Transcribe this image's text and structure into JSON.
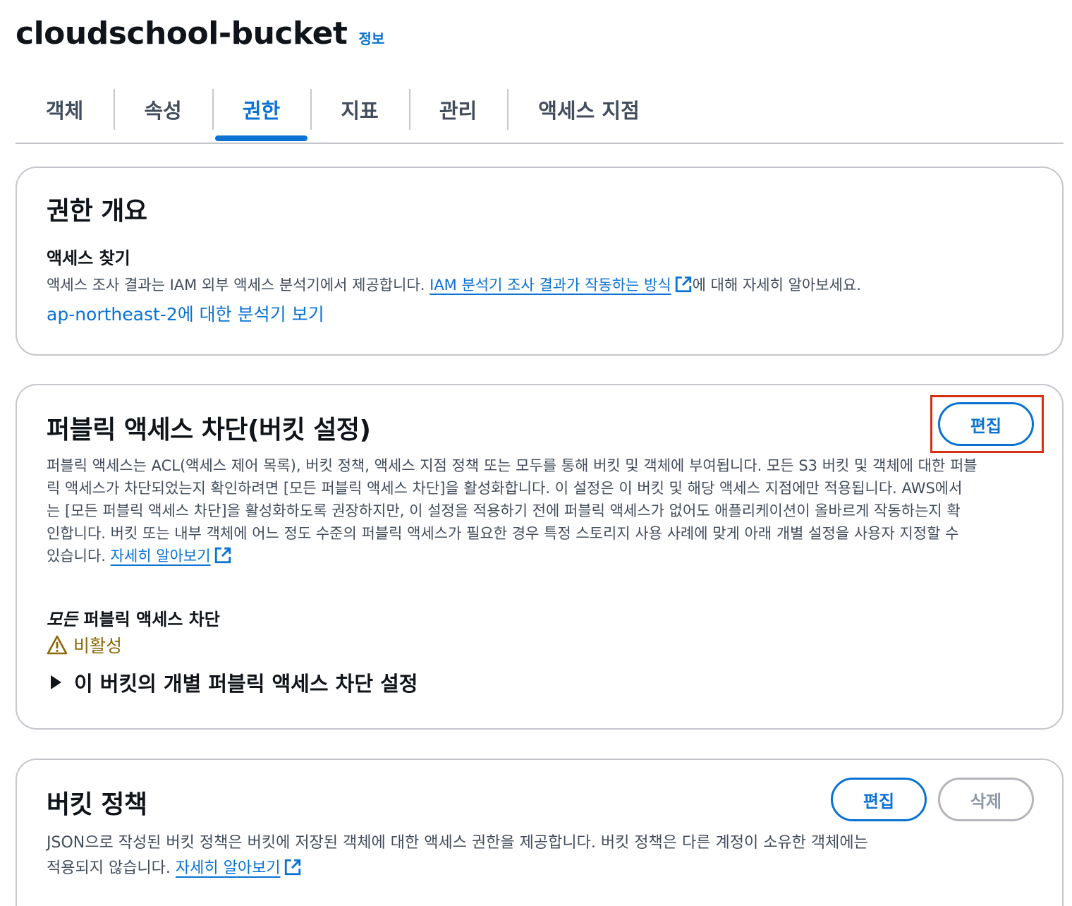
{
  "header": {
    "title": "cloudschool-bucket",
    "info": "정보"
  },
  "tabs": [
    {
      "label": "객체"
    },
    {
      "label": "속성"
    },
    {
      "label": "권한"
    },
    {
      "label": "지표"
    },
    {
      "label": "관리"
    },
    {
      "label": "액세스 지점"
    }
  ],
  "active_tab": "권한",
  "overview": {
    "title": "권한 개요",
    "find_access_title": "액세스 찾기",
    "desc_before": "액세스 조사 결과는 IAM 외부 액세스 분석기에서 제공합니다. ",
    "desc_link": "IAM 분석기 조사 결과가 작동하는 방식",
    "desc_after": "에 대해 자세히 알아보세요.",
    "analyzer_link": "ap-northeast-2에 대한 분석기 보기"
  },
  "public_access": {
    "title": "퍼블릭 액세스 차단(버킷 설정)",
    "edit_label": "편집",
    "desc_lines": [
      "퍼블릭 액세스는 ACL(액세스 제어 목록), 버킷 정책, 액세스 지점 정책 또는 모두를 통해 버킷 및 객체에 부여됩니다. 모든 S3 버킷 및 객체에 대한 퍼블",
      "릭 액세스가 차단되었는지 확인하려면 [모든 퍼블릭 액세스 차단]을 활성화합니다. 이 설정은 이 버킷 및 해당 액세스 지점에만 적용됩니다. AWS에서",
      "는 [모든 퍼블릭 액세스 차단]을 활성화하도록 권장하지만, 이 설정을 적용하기 전에 퍼블릭 액세스가 없어도 애플리케이션이 올바르게 작동하는지 확",
      "인합니다. 버킷 또는 내부 객체에 어느 정도 수준의 퍼블릭 액세스가 필요한 경우 특정 스토리지 사용 사례에 맞게 아래 개별 설정을 사용자 지정할 수"
    ],
    "desc_last_prefix": "있습니다. ",
    "learn_more": "자세히 알아보기",
    "block_all_em": "모든",
    "block_all_rest": " 퍼블릭 액세스 차단",
    "status": "비활성",
    "expander_label": "이 버킷의 개별 퍼블릭 액세스 차단 설정"
  },
  "bucket_policy": {
    "title": "버킷 정책",
    "edit_label": "편집",
    "delete_label": "삭제",
    "desc_line1": "JSON으로 작성된 버킷 정책은 버킷에 저장된 객체에 대한 액세스 권한을 제공합니다. 버킷 정책은 다른 계정이 소유한 객체에는",
    "desc_line2_prefix": "적용되지 않습니다. ",
    "learn_more": "자세히 알아보기"
  },
  "colors": {
    "link": "#0972d3",
    "warning": "#8d6605",
    "highlight": "#d13212",
    "border": "#c6c6cd"
  },
  "icons": {
    "external": "external-link-icon",
    "warning": "warning-icon",
    "caret": "caret-right-icon"
  }
}
